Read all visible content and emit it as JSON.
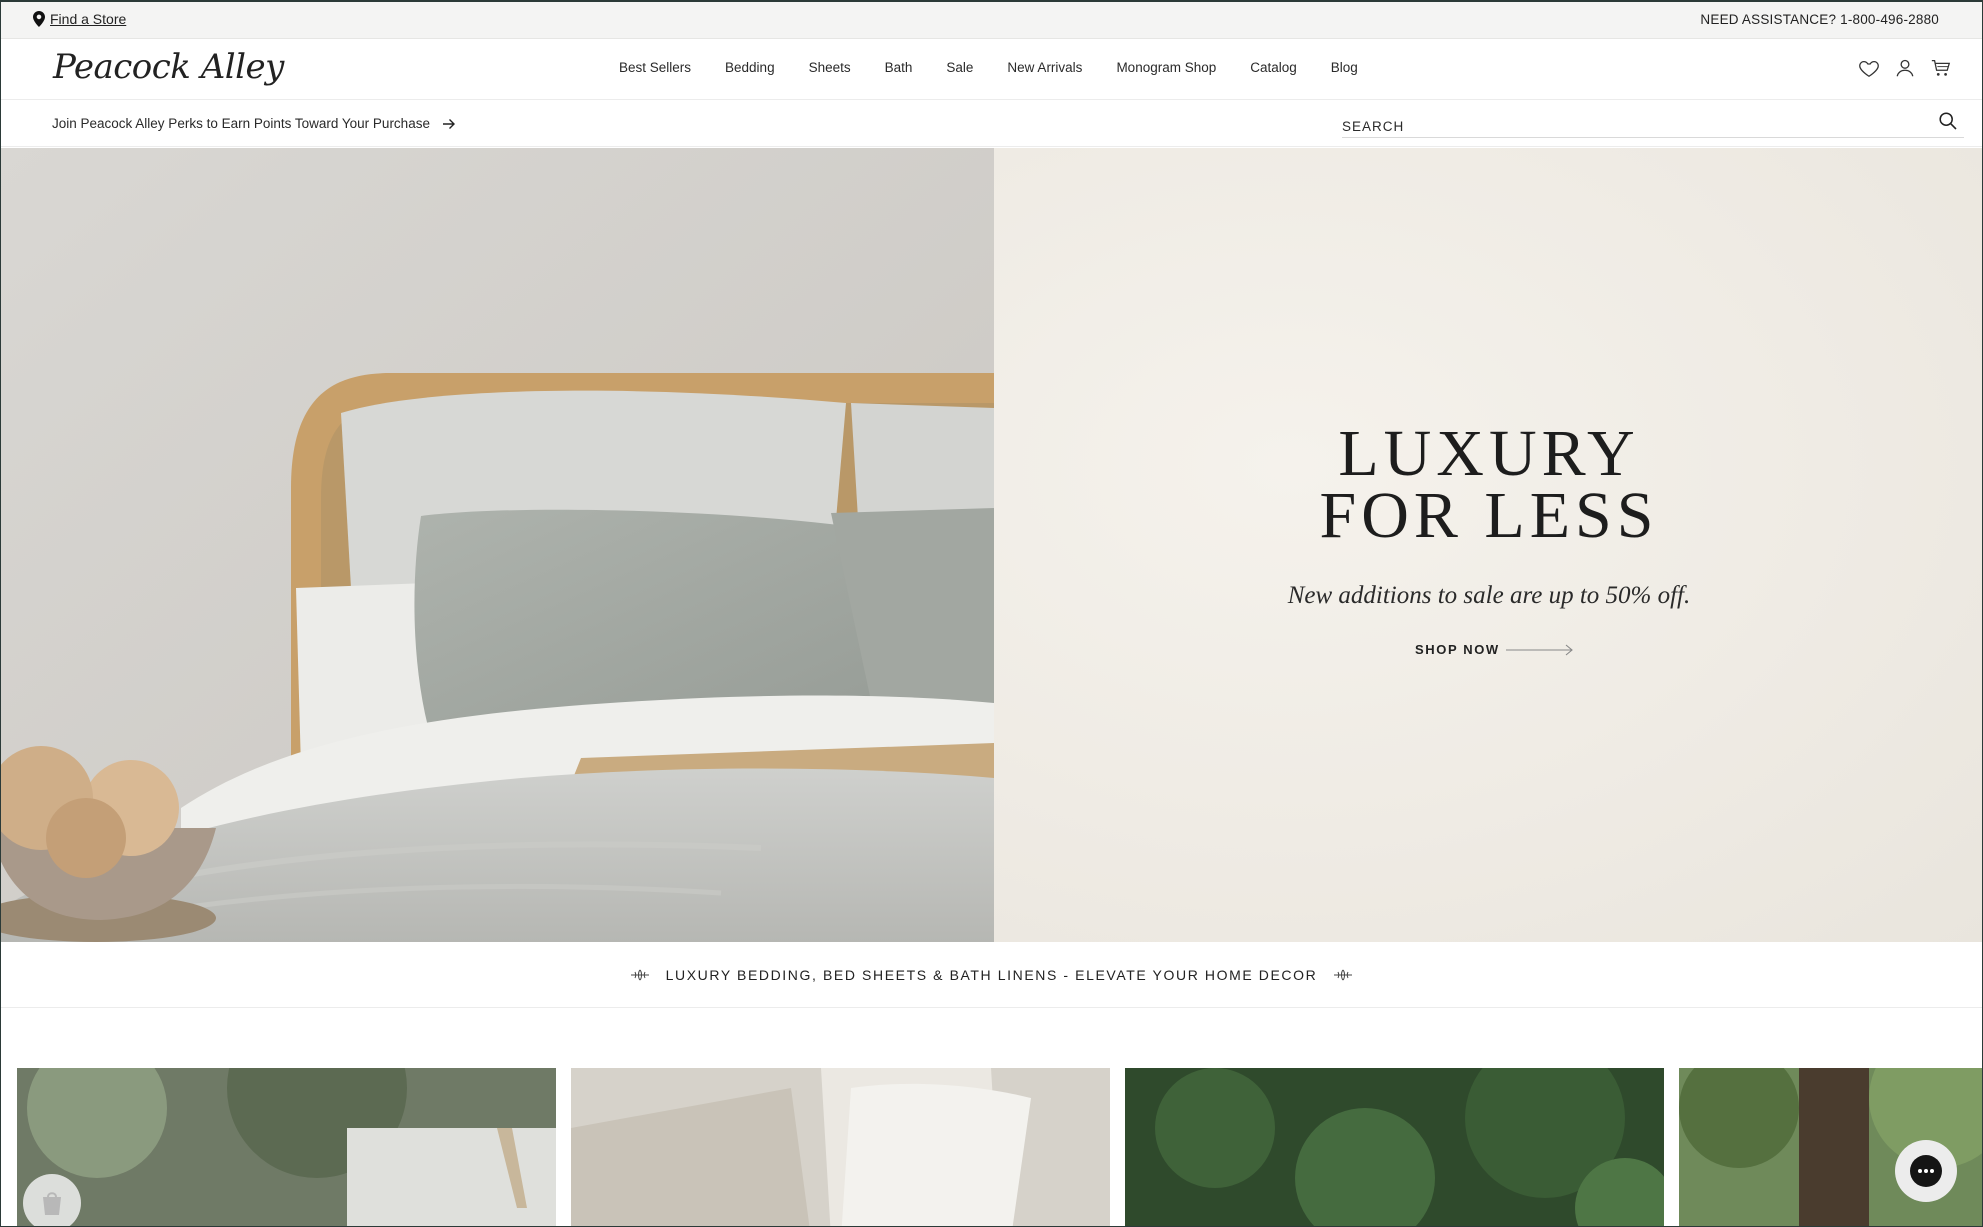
{
  "utility": {
    "find_store": "Find a Store",
    "assistance": "NEED ASSISTANCE? 1-800-496-2880"
  },
  "header": {
    "logo_text": "Peacock Alley",
    "nav": [
      "Best Sellers",
      "Bedding",
      "Sheets",
      "Bath",
      "Sale",
      "New Arrivals",
      "Monogram Shop",
      "Catalog",
      "Blog"
    ],
    "icons": [
      "heart-icon",
      "account-icon",
      "cart-icon"
    ]
  },
  "perks": {
    "text": "Join Peacock Alley Perks to Earn Points Toward Your Purchase"
  },
  "search": {
    "placeholder": "SEARCH"
  },
  "hero": {
    "title_line1": "LUXURY",
    "title_line2": "FOR LESS",
    "subtitle": "New additions to sale are up to 50% off.",
    "cta": "SHOP NOW"
  },
  "tagline": {
    "text": "LUXURY BEDDING, BED SHEETS & BATH LINENS - ELEVATE YOUR HOME DECOR"
  },
  "colors": {
    "utility_bg": "#f4f4f3",
    "hero_copy_bg": "#efebe4",
    "text_dark": "#1d1d1d"
  }
}
